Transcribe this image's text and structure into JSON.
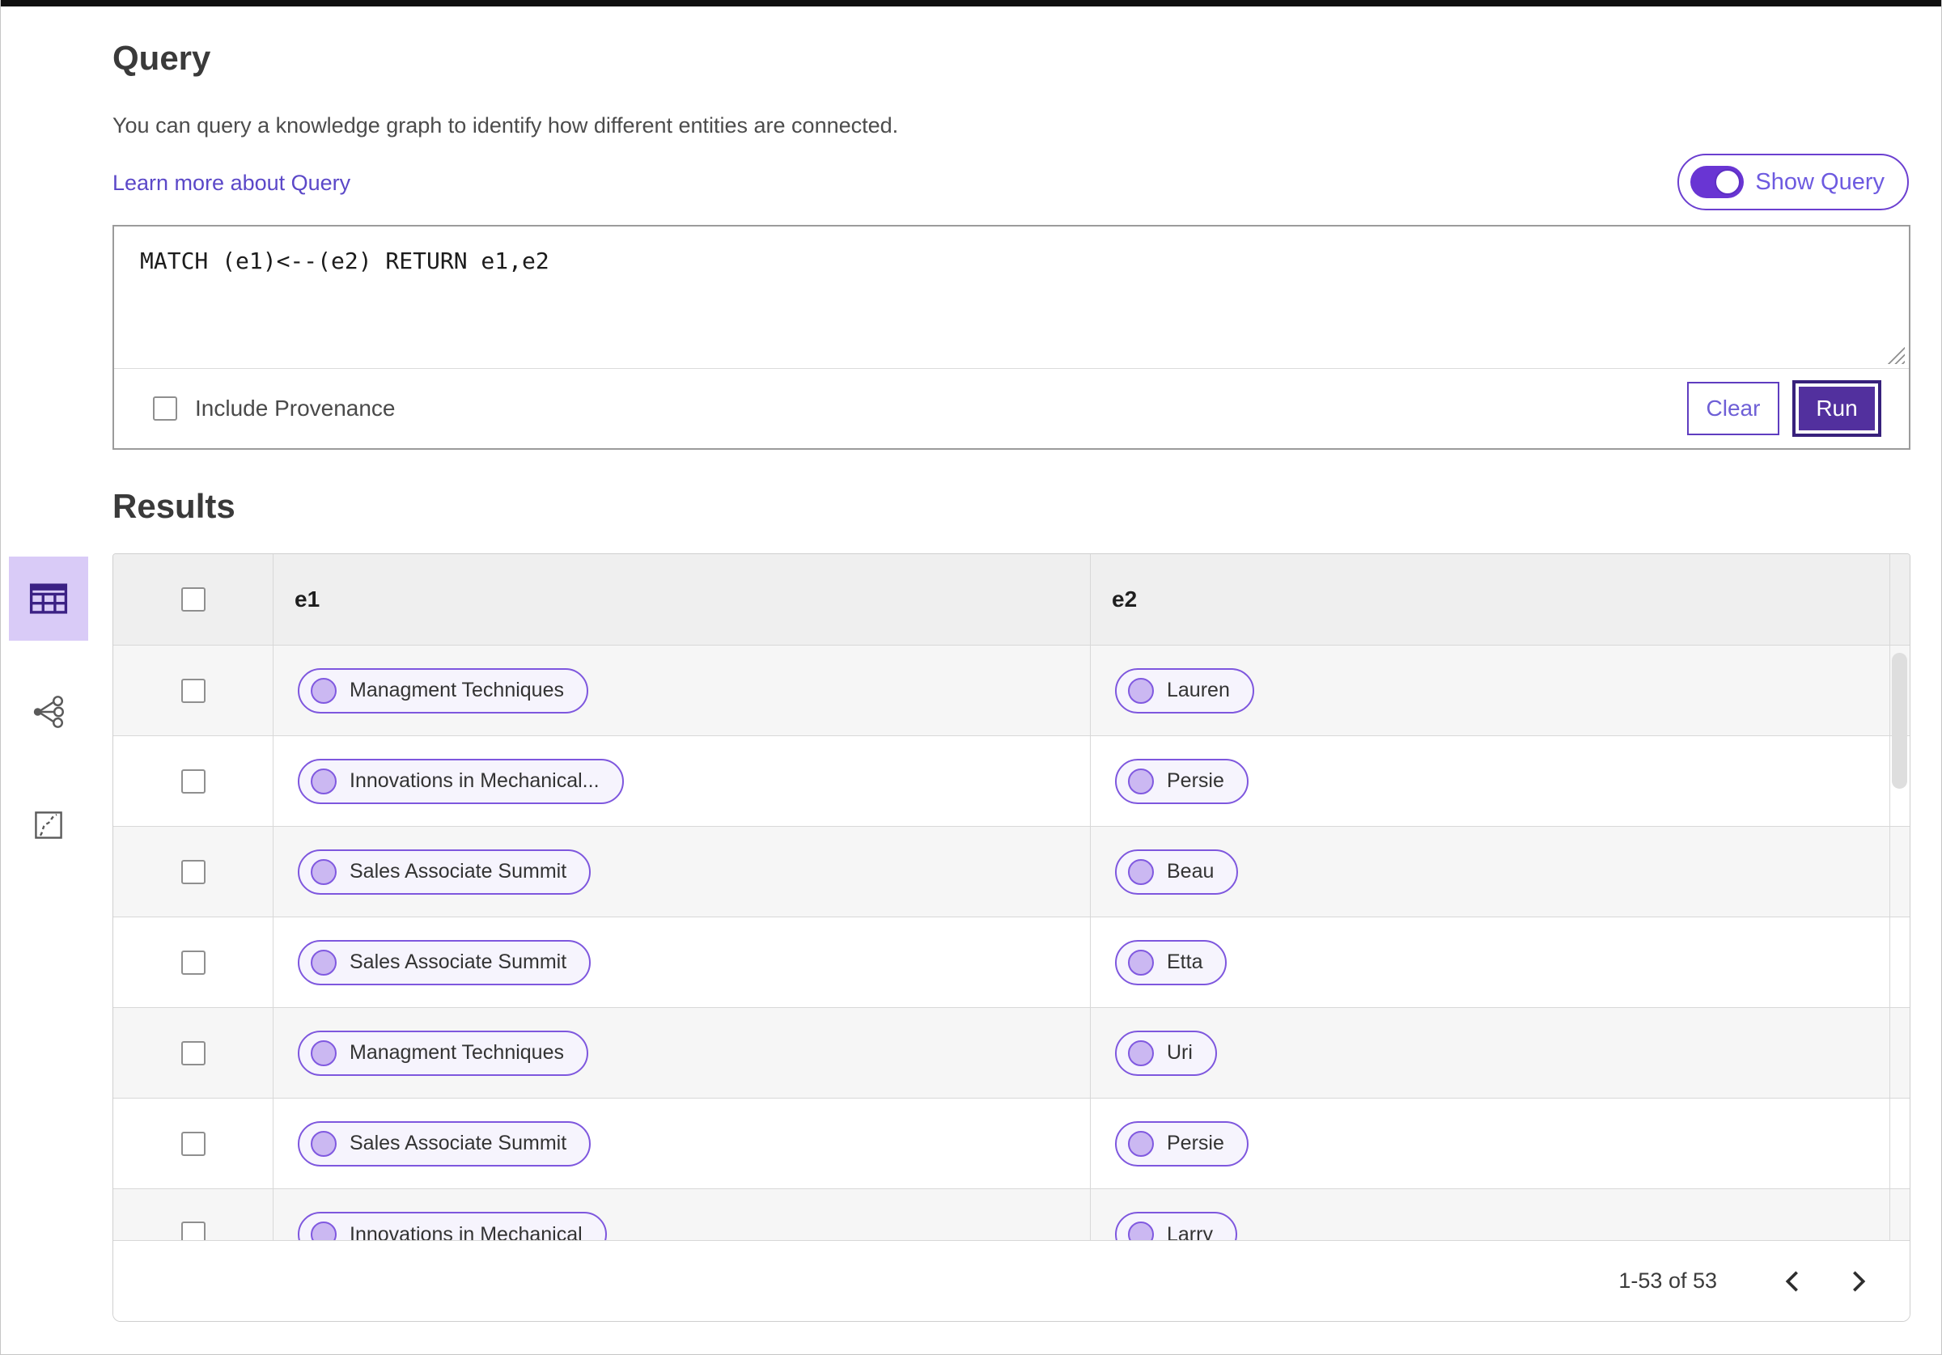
{
  "query_panel": {
    "title": "Query",
    "description": "You can query a knowledge graph to identify how different entities are connected.",
    "learn_more_link": "Learn more about Query",
    "show_query_toggle": {
      "label": "Show Query",
      "state": "on"
    },
    "editor_text": "MATCH (e1)<--(e2) RETURN e1,e2",
    "include_provenance": {
      "label": "Include Provenance",
      "checked": false
    },
    "buttons": {
      "clear": "Clear",
      "run": "Run"
    }
  },
  "results_panel": {
    "title": "Results",
    "view_switcher": [
      {
        "name": "table-view",
        "icon": "table-icon",
        "active": true
      },
      {
        "name": "graph-view",
        "icon": "network-icon",
        "active": false
      },
      {
        "name": "map-view",
        "icon": "map-route-icon",
        "active": false
      }
    ],
    "table": {
      "columns": [
        {
          "key": "e1",
          "label": "e1"
        },
        {
          "key": "e2",
          "label": "e2"
        }
      ],
      "select_all_checked": false,
      "rows": [
        {
          "e1": "Managment Techniques",
          "e2": "Lauren",
          "checked": false
        },
        {
          "e1": "Innovations in Mechanical...",
          "e2": "Persie",
          "checked": false
        },
        {
          "e1": "Sales Associate Summit",
          "e2": "Beau",
          "checked": false
        },
        {
          "e1": "Sales Associate Summit",
          "e2": "Etta",
          "checked": false
        },
        {
          "e1": "Managment Techniques",
          "e2": "Uri",
          "checked": false
        },
        {
          "e1": "Sales Associate Summit",
          "e2": "Persie",
          "checked": false
        },
        {
          "e1": "Innovations in Mechanical",
          "e2": "Larry",
          "checked": false
        }
      ],
      "pagination": {
        "range_label": "1-53 of 53",
        "prev_icon": "chevron-left",
        "next_icon": "chevron-right"
      }
    }
  },
  "colors": {
    "accent_purple": "#52309e",
    "toggle_purple": "#6935d3",
    "pill_border": "#7e57de",
    "pill_bg": "#f6f4fd",
    "pill_dot": "#cbb8f2",
    "link": "#5b48c8",
    "active_view_bg": "#d9cbf7"
  }
}
